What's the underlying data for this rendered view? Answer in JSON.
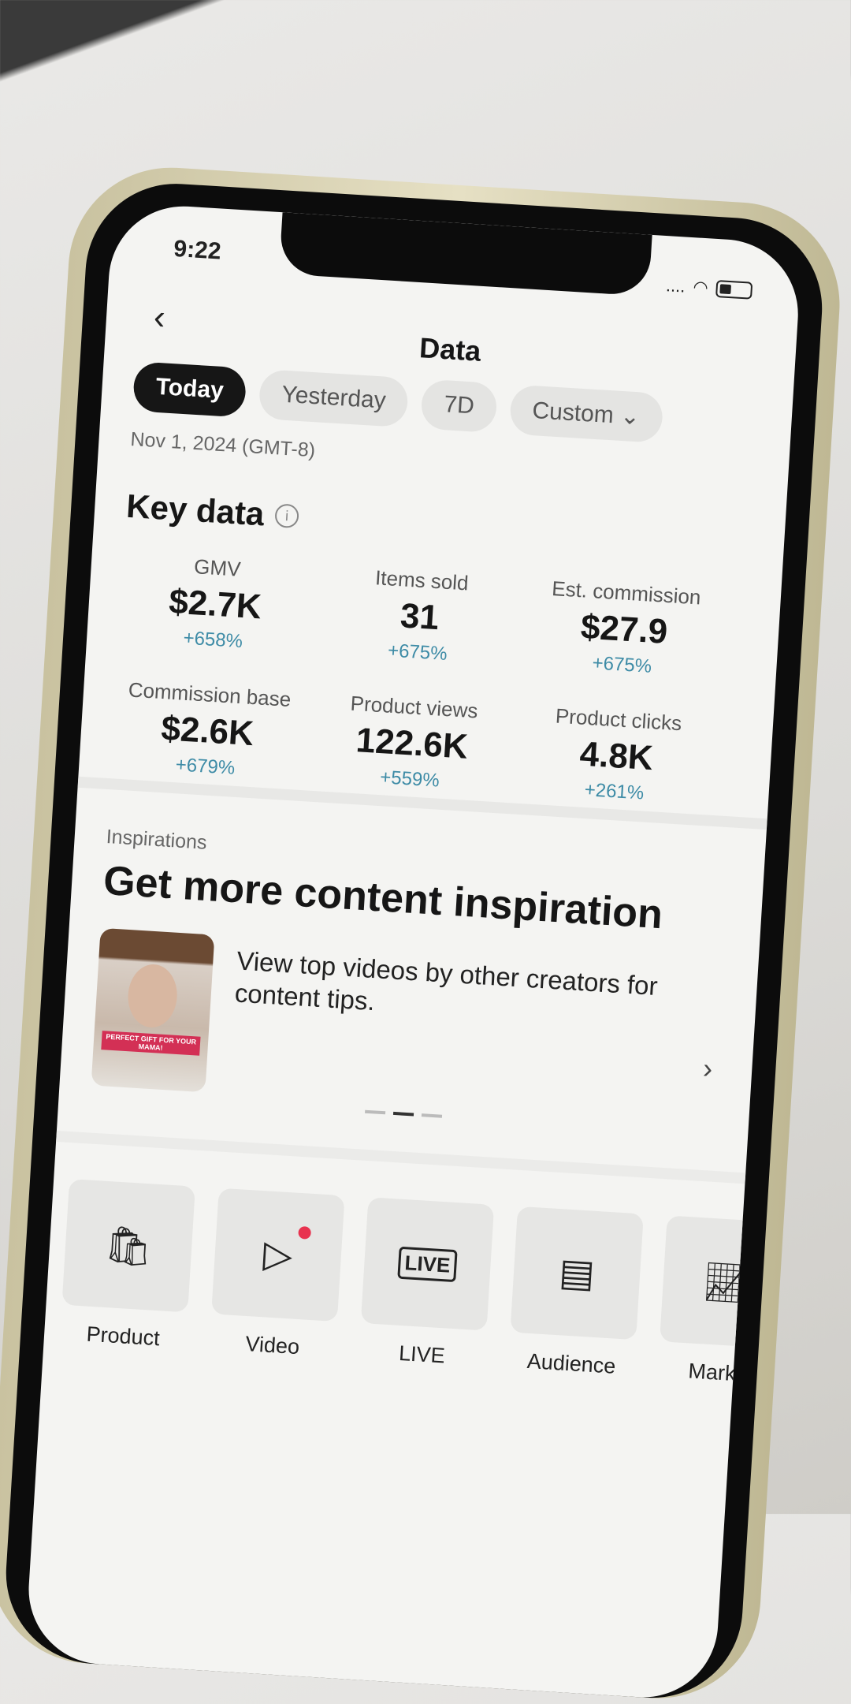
{
  "status_bar": {
    "time": "9:22",
    "signal": "....",
    "wifi_icon": "wifi-icon",
    "battery_icon": "battery-icon"
  },
  "header": {
    "title": "Data",
    "back_icon": "chevron-left-icon"
  },
  "date_filters": [
    {
      "label": "Today",
      "active": true
    },
    {
      "label": "Yesterday"
    },
    {
      "label": "7D"
    },
    {
      "label": "Custom ⌄"
    }
  ],
  "date_label": "Nov 1, 2024 (GMT-8)",
  "key_data": {
    "title": "Key data",
    "info_icon": "i",
    "metrics": [
      {
        "label": "GMV",
        "value": "$2.7K",
        "change": "+658%"
      },
      {
        "label": "Items sold",
        "value": "31",
        "change": "+675%"
      },
      {
        "label": "Est. commission",
        "value": "$27.9",
        "change": "+675%"
      },
      {
        "label": "Commission base",
        "value": "$2.6K",
        "change": "+679%"
      },
      {
        "label": "Product views",
        "value": "122.6K",
        "change": "+559%"
      },
      {
        "label": "Product clicks",
        "value": "4.8K",
        "change": "+261%"
      }
    ]
  },
  "inspirations": {
    "section": "Inspirations",
    "heading": "Get more content inspiration",
    "description": "View top videos by other creators for content tips.",
    "thumbnail_caption": "PERFECT GIFT FOR YOUR MAMA!",
    "carousel_page": 2,
    "carousel_total": 3
  },
  "tools": [
    {
      "label": "Product",
      "icon": "shopping-bag-icon"
    },
    {
      "label": "Video",
      "icon": "play-icon",
      "badge": true
    },
    {
      "label": "LIVE",
      "icon": "live-tv-icon",
      "glyph": "LIVE"
    },
    {
      "label": "Audience",
      "icon": "id-card-icon"
    },
    {
      "label": "Market",
      "icon": "chart-icon"
    }
  ],
  "colors": {
    "positive_change": "#3d8ba6",
    "badge": "#e8334f",
    "active_chip": "#161616"
  }
}
